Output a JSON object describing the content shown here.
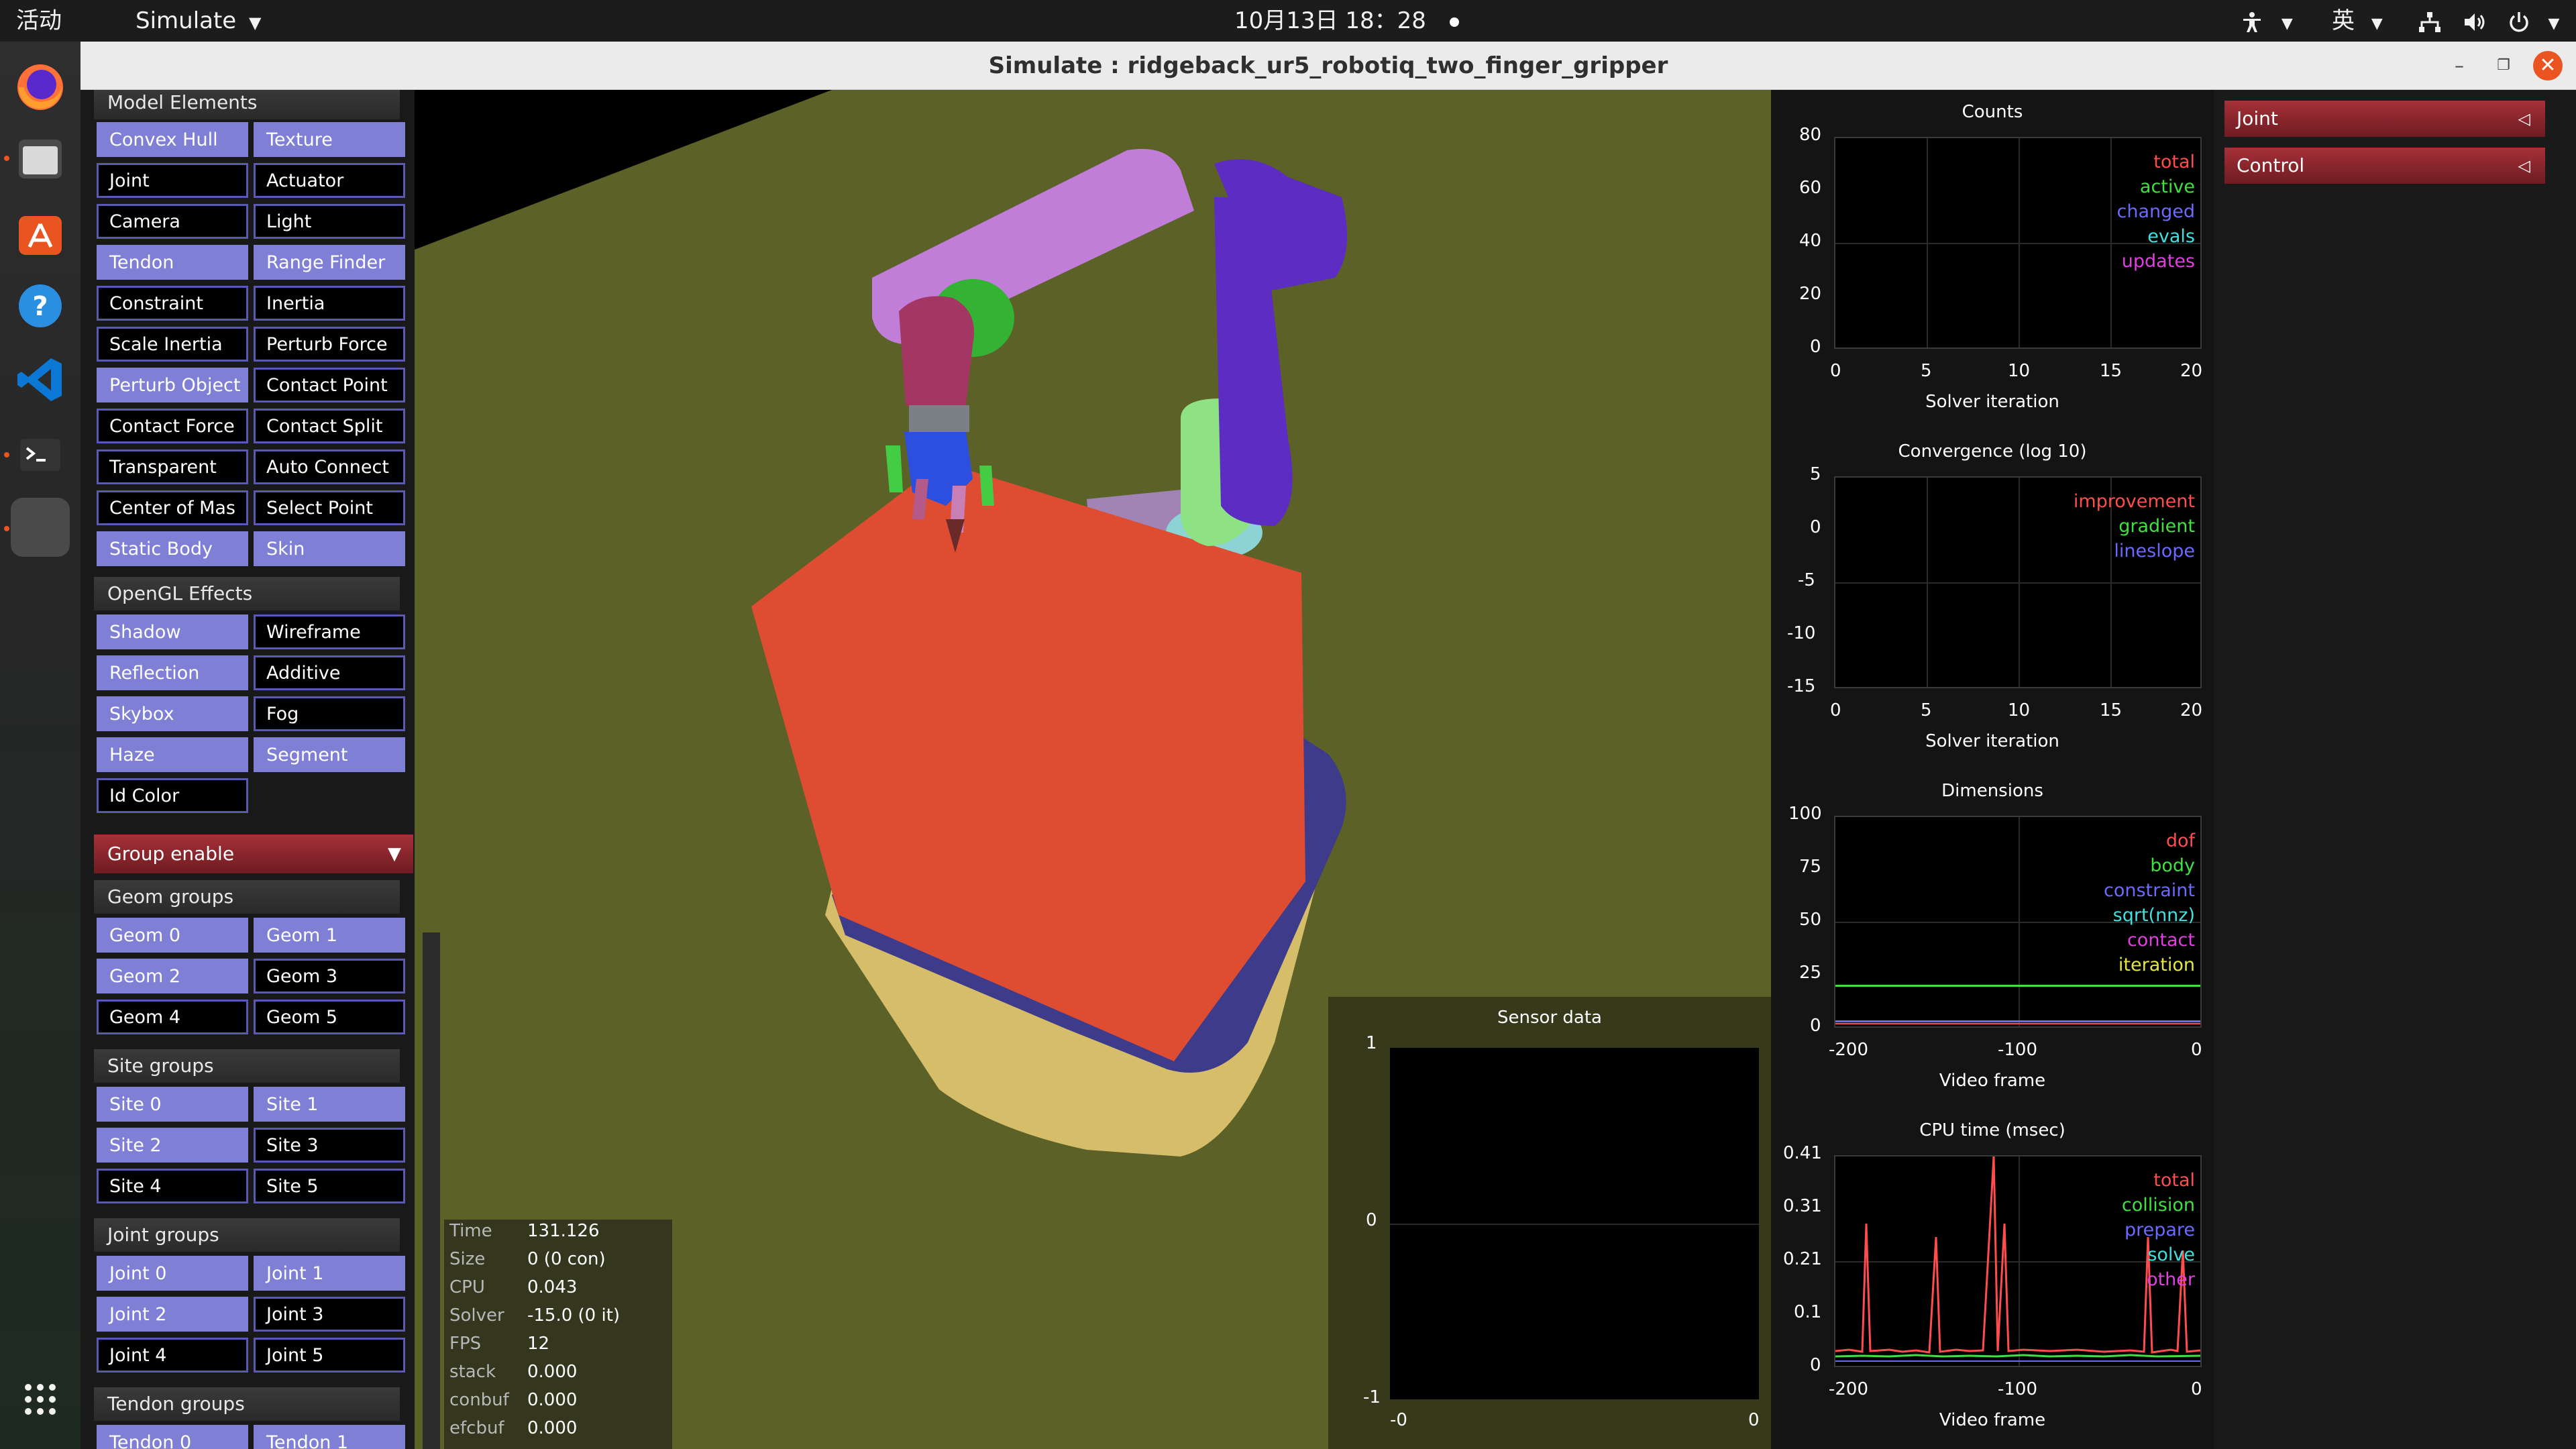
{
  "topbar": {
    "activities": "活动",
    "app_menu": "Simulate",
    "clock": "10月13日 18：28",
    "input_method": "英"
  },
  "window": {
    "title": "Simulate : ridgeback_ur5_robotiq_two_finger_gripper"
  },
  "left_panel": {
    "model_elements": {
      "header": "Model Elements",
      "buttons": [
        {
          "label": "Convex Hull",
          "on": false
        },
        {
          "label": "Texture",
          "on": true
        },
        {
          "label": "Joint",
          "on": false
        },
        {
          "label": "Actuator",
          "on": false
        },
        {
          "label": "Camera",
          "on": false
        },
        {
          "label": "Light",
          "on": false
        },
        {
          "label": "Tendon",
          "on": true
        },
        {
          "label": "Range Finder",
          "on": true
        },
        {
          "label": "Constraint",
          "on": false
        },
        {
          "label": "Inertia",
          "on": false
        },
        {
          "label": "Scale Inertia",
          "on": false
        },
        {
          "label": "Perturb Force",
          "on": false
        },
        {
          "label": "Perturb Object",
          "on": true
        },
        {
          "label": "Contact Point",
          "on": false
        },
        {
          "label": "Contact Force",
          "on": false
        },
        {
          "label": "Contact Split",
          "on": false
        },
        {
          "label": "Transparent",
          "on": false
        },
        {
          "label": "Auto Connect",
          "on": false
        },
        {
          "label": "Center of Mas",
          "on": false
        },
        {
          "label": "Select Point",
          "on": false
        },
        {
          "label": "Static Body",
          "on": true
        },
        {
          "label": "Skin",
          "on": true
        }
      ]
    },
    "opengl_effects": {
      "header": "OpenGL Effects",
      "buttons": [
        {
          "label": "Shadow",
          "on": true
        },
        {
          "label": "Wireframe",
          "on": false
        },
        {
          "label": "Reflection",
          "on": true
        },
        {
          "label": "Additive",
          "on": false
        },
        {
          "label": "Skybox",
          "on": true
        },
        {
          "label": "Fog",
          "on": false
        },
        {
          "label": "Haze",
          "on": true
        },
        {
          "label": "Segment",
          "on": true
        },
        {
          "label": "Id Color",
          "on": false
        }
      ]
    },
    "group_enable": "Group enable",
    "geom_groups": {
      "header": "Geom groups",
      "buttons": [
        {
          "label": "Geom 0",
          "on": true
        },
        {
          "label": "Geom 1",
          "on": true
        },
        {
          "label": "Geom 2",
          "on": true
        },
        {
          "label": "Geom 3",
          "on": false
        },
        {
          "label": "Geom 4",
          "on": false
        },
        {
          "label": "Geom 5",
          "on": false
        }
      ]
    },
    "site_groups": {
      "header": "Site groups",
      "buttons": [
        {
          "label": "Site 0",
          "on": true
        },
        {
          "label": "Site 1",
          "on": true
        },
        {
          "label": "Site 2",
          "on": true
        },
        {
          "label": "Site 3",
          "on": false
        },
        {
          "label": "Site 4",
          "on": false
        },
        {
          "label": "Site 5",
          "on": false
        }
      ]
    },
    "joint_groups": {
      "header": "Joint groups",
      "buttons": [
        {
          "label": "Joint 0",
          "on": true
        },
        {
          "label": "Joint 1",
          "on": true
        },
        {
          "label": "Joint 2",
          "on": true
        },
        {
          "label": "Joint 3",
          "on": false
        },
        {
          "label": "Joint 4",
          "on": false
        },
        {
          "label": "Joint 5",
          "on": false
        }
      ]
    },
    "tendon_groups": {
      "header": "Tendon groups",
      "buttons": [
        {
          "label": "Tendon 0",
          "on": true
        },
        {
          "label": "Tendon 1",
          "on": true
        }
      ]
    }
  },
  "info": {
    "rows": [
      {
        "key": "Time",
        "value": "131.126"
      },
      {
        "key": "Size",
        "value": "0  (0 con)"
      },
      {
        "key": "CPU",
        "value": "0.043"
      },
      {
        "key": "Solver",
        "value": "-15.0  (0 it)"
      },
      {
        "key": "FPS",
        "value": "12"
      },
      {
        "key": "stack",
        "value": "0.000"
      },
      {
        "key": "conbuf",
        "value": "0.000"
      },
      {
        "key": "efcbuf",
        "value": "0.000"
      }
    ]
  },
  "sensor": {
    "title": "Sensor data",
    "y_ticks": [
      "1",
      "0",
      "-1"
    ],
    "x_ticks": [
      "-0",
      "0"
    ]
  },
  "profiler": {
    "counts": {
      "title": "Counts",
      "y_ticks": [
        "80",
        "60",
        "40",
        "20",
        "0"
      ],
      "x_ticks": [
        "0",
        "5",
        "10",
        "15",
        "20"
      ],
      "xlabel": "Solver iteration",
      "legend": [
        {
          "name": "total",
          "color": "#ff4d4d"
        },
        {
          "name": "active",
          "color": "#40e040"
        },
        {
          "name": "changed",
          "color": "#6a6aff"
        },
        {
          "name": "evals",
          "color": "#40e0e0"
        },
        {
          "name": "updates",
          "color": "#e040e0"
        }
      ]
    },
    "convergence": {
      "title": "Convergence (log 10)",
      "y_ticks": [
        "5",
        "0",
        "-5",
        "-10",
        "-15"
      ],
      "x_ticks": [
        "0",
        "5",
        "10",
        "15",
        "20"
      ],
      "xlabel": "Solver iteration",
      "legend": [
        {
          "name": "improvement",
          "color": "#ff4d4d"
        },
        {
          "name": "gradient",
          "color": "#40e040"
        },
        {
          "name": "lineslope",
          "color": "#6a6aff"
        }
      ]
    },
    "dimensions": {
      "title": "Dimensions",
      "y_ticks": [
        "100",
        "75",
        "50",
        "25",
        "0"
      ],
      "x_ticks": [
        "-200",
        "-100",
        "0"
      ],
      "xlabel": "Video frame",
      "legend": [
        {
          "name": "dof",
          "color": "#ff4d4d"
        },
        {
          "name": "body",
          "color": "#40e040"
        },
        {
          "name": "constraint",
          "color": "#6a6aff"
        },
        {
          "name": "sqrt(nnz)",
          "color": "#40e0e0"
        },
        {
          "name": "contact",
          "color": "#e040e0"
        },
        {
          "name": "iteration",
          "color": "#e6e640"
        }
      ]
    },
    "cpu": {
      "title": "CPU time (msec)",
      "y_ticks": [
        "0.41",
        "0.31",
        "0.21",
        "0.1",
        "0"
      ],
      "x_ticks": [
        "-200",
        "-100",
        "0"
      ],
      "xlabel": "Video frame",
      "legend": [
        {
          "name": "total",
          "color": "#ff4d4d"
        },
        {
          "name": "collision",
          "color": "#40e040"
        },
        {
          "name": "prepare",
          "color": "#6a6aff"
        },
        {
          "name": "solve",
          "color": "#40e0e0"
        },
        {
          "name": "other",
          "color": "#e040e0"
        }
      ]
    }
  },
  "right_panel": {
    "buttons": [
      {
        "label": "Joint"
      },
      {
        "label": "Control"
      }
    ]
  }
}
